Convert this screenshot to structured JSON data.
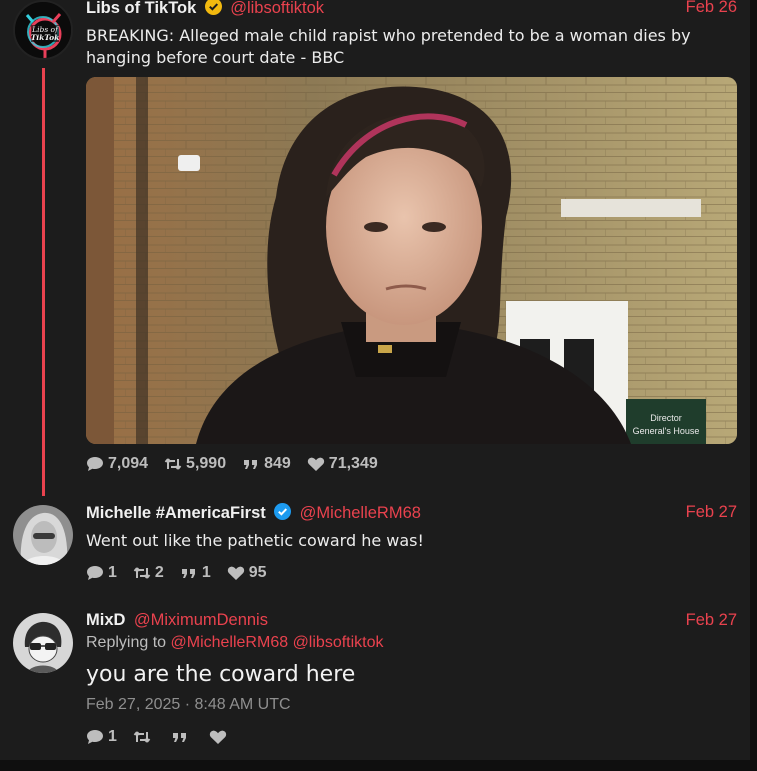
{
  "tweets": [
    {
      "author": "Libs of TikTok",
      "handle": "@libsoftiktok",
      "date": "Feb 26",
      "verified_color": "#f2b90f",
      "avatar_text": [
        "Libs of",
        "TikTok"
      ],
      "text": "BREAKING: Alleged male child rapist who pretended to be a woman dies by hanging before court date - BBC",
      "media": {
        "sign_text": [
          "Director",
          "General's House"
        ]
      },
      "stats": {
        "replies": "7,094",
        "retweets": "5,990",
        "quotes": "849",
        "likes": "71,349"
      }
    },
    {
      "author": "Michelle #AmericaFirst",
      "handle": "@MichelleRM68",
      "date": "Feb 27",
      "verified_color": "#1d9bf0",
      "text": "Went out like the pathetic coward he was!",
      "stats": {
        "replies": "1",
        "retweets": "2",
        "quotes": "1",
        "likes": "95"
      }
    },
    {
      "author": "MixD",
      "handle": "@MiximumDennis",
      "date": "Feb 27",
      "replying_label": "Replying to",
      "replying_to": [
        "@MichelleRM68",
        "@libsoftiktok"
      ],
      "text": "you are the coward here",
      "timestamp": "Feb 27, 2025 · 8:48 AM UTC",
      "stats": {
        "replies": "1",
        "retweets": "",
        "quotes": "",
        "likes": ""
      }
    }
  ],
  "colors": {
    "accent": "#e9424e",
    "background": "#1c1c1c",
    "text": "#ececec",
    "muted": "#bdbdbd"
  }
}
